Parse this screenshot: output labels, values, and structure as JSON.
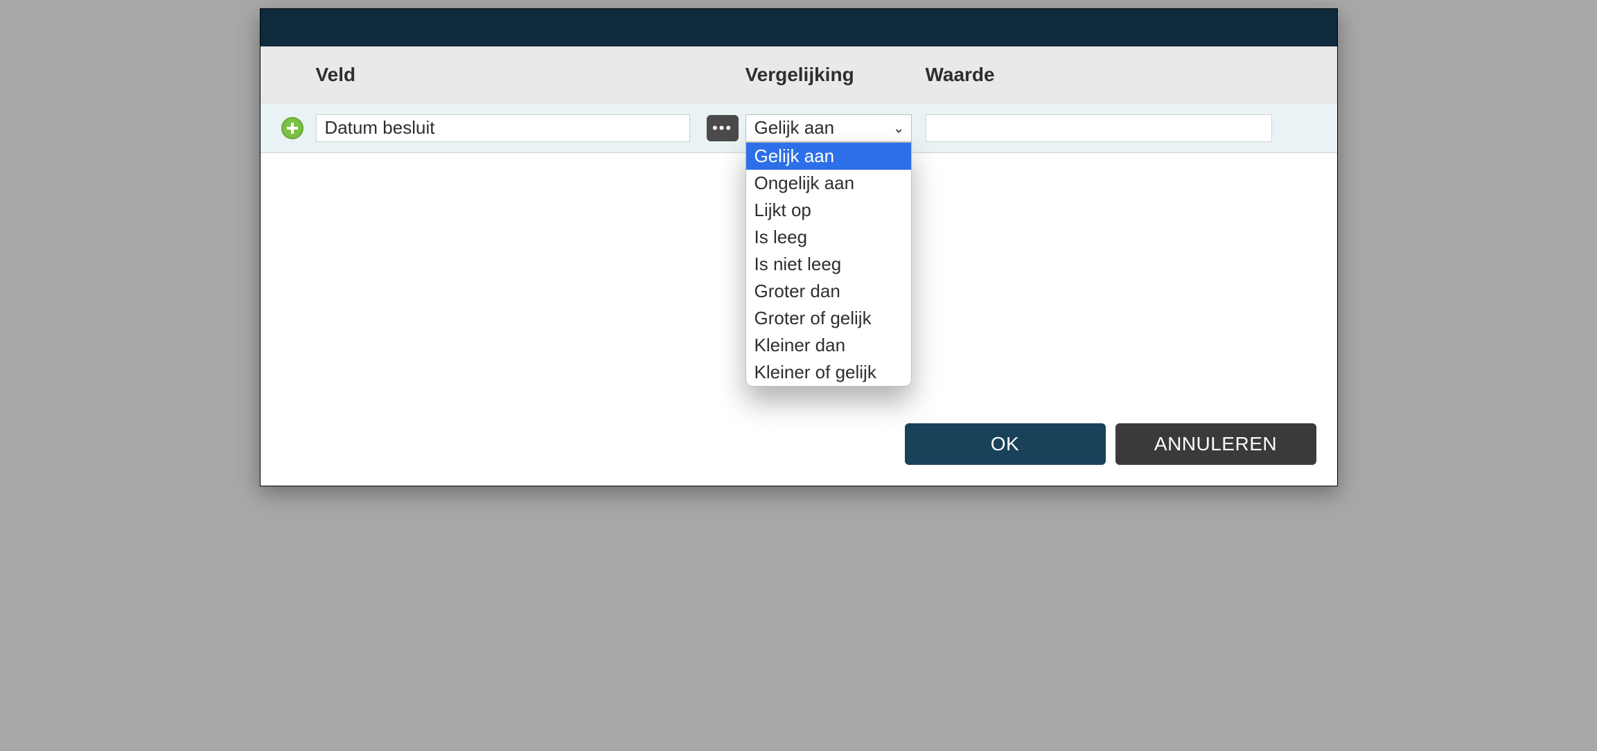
{
  "headers": {
    "field": "Veld",
    "comparison": "Vergelijking",
    "value": "Waarde"
  },
  "row": {
    "field_value": "Datum besluit",
    "comparison_selected": "Gelijk aan",
    "value_value": ""
  },
  "comparison_options": [
    "Gelijk aan",
    "Ongelijk aan",
    "Lijkt op",
    "Is leeg",
    "Is niet leeg",
    "Groter dan",
    "Groter of gelijk",
    "Kleiner dan",
    "Kleiner of gelijk"
  ],
  "footer": {
    "ok": "OK",
    "cancel": "ANNULEREN"
  },
  "icons": {
    "add": "add-icon",
    "more": "more-icon",
    "chevron": "chevron-down-icon"
  }
}
